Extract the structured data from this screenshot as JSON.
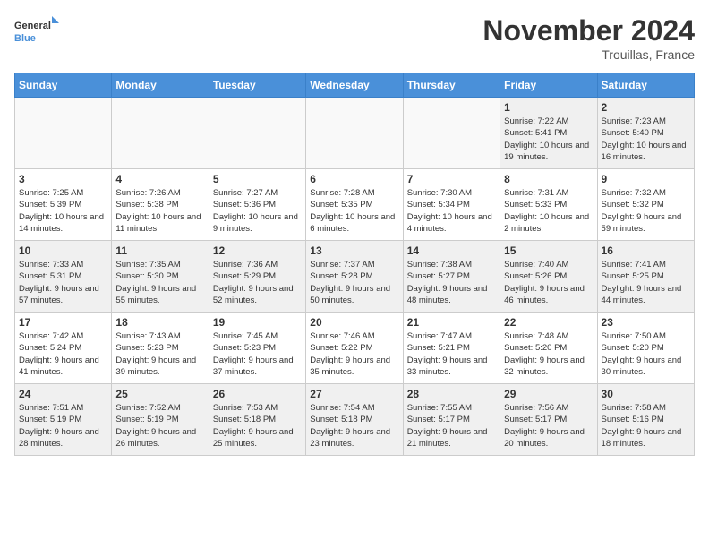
{
  "logo": {
    "line1": "General",
    "line2": "Blue"
  },
  "title": "November 2024",
  "location": "Trouillas, France",
  "days_of_week": [
    "Sunday",
    "Monday",
    "Tuesday",
    "Wednesday",
    "Thursday",
    "Friday",
    "Saturday"
  ],
  "weeks": [
    [
      {
        "day": "",
        "info": ""
      },
      {
        "day": "",
        "info": ""
      },
      {
        "day": "",
        "info": ""
      },
      {
        "day": "",
        "info": ""
      },
      {
        "day": "",
        "info": ""
      },
      {
        "day": "1",
        "info": "Sunrise: 7:22 AM\nSunset: 5:41 PM\nDaylight: 10 hours and 19 minutes."
      },
      {
        "day": "2",
        "info": "Sunrise: 7:23 AM\nSunset: 5:40 PM\nDaylight: 10 hours and 16 minutes."
      }
    ],
    [
      {
        "day": "3",
        "info": "Sunrise: 7:25 AM\nSunset: 5:39 PM\nDaylight: 10 hours and 14 minutes."
      },
      {
        "day": "4",
        "info": "Sunrise: 7:26 AM\nSunset: 5:38 PM\nDaylight: 10 hours and 11 minutes."
      },
      {
        "day": "5",
        "info": "Sunrise: 7:27 AM\nSunset: 5:36 PM\nDaylight: 10 hours and 9 minutes."
      },
      {
        "day": "6",
        "info": "Sunrise: 7:28 AM\nSunset: 5:35 PM\nDaylight: 10 hours and 6 minutes."
      },
      {
        "day": "7",
        "info": "Sunrise: 7:30 AM\nSunset: 5:34 PM\nDaylight: 10 hours and 4 minutes."
      },
      {
        "day": "8",
        "info": "Sunrise: 7:31 AM\nSunset: 5:33 PM\nDaylight: 10 hours and 2 minutes."
      },
      {
        "day": "9",
        "info": "Sunrise: 7:32 AM\nSunset: 5:32 PM\nDaylight: 9 hours and 59 minutes."
      }
    ],
    [
      {
        "day": "10",
        "info": "Sunrise: 7:33 AM\nSunset: 5:31 PM\nDaylight: 9 hours and 57 minutes."
      },
      {
        "day": "11",
        "info": "Sunrise: 7:35 AM\nSunset: 5:30 PM\nDaylight: 9 hours and 55 minutes."
      },
      {
        "day": "12",
        "info": "Sunrise: 7:36 AM\nSunset: 5:29 PM\nDaylight: 9 hours and 52 minutes."
      },
      {
        "day": "13",
        "info": "Sunrise: 7:37 AM\nSunset: 5:28 PM\nDaylight: 9 hours and 50 minutes."
      },
      {
        "day": "14",
        "info": "Sunrise: 7:38 AM\nSunset: 5:27 PM\nDaylight: 9 hours and 48 minutes."
      },
      {
        "day": "15",
        "info": "Sunrise: 7:40 AM\nSunset: 5:26 PM\nDaylight: 9 hours and 46 minutes."
      },
      {
        "day": "16",
        "info": "Sunrise: 7:41 AM\nSunset: 5:25 PM\nDaylight: 9 hours and 44 minutes."
      }
    ],
    [
      {
        "day": "17",
        "info": "Sunrise: 7:42 AM\nSunset: 5:24 PM\nDaylight: 9 hours and 41 minutes."
      },
      {
        "day": "18",
        "info": "Sunrise: 7:43 AM\nSunset: 5:23 PM\nDaylight: 9 hours and 39 minutes."
      },
      {
        "day": "19",
        "info": "Sunrise: 7:45 AM\nSunset: 5:23 PM\nDaylight: 9 hours and 37 minutes."
      },
      {
        "day": "20",
        "info": "Sunrise: 7:46 AM\nSunset: 5:22 PM\nDaylight: 9 hours and 35 minutes."
      },
      {
        "day": "21",
        "info": "Sunrise: 7:47 AM\nSunset: 5:21 PM\nDaylight: 9 hours and 33 minutes."
      },
      {
        "day": "22",
        "info": "Sunrise: 7:48 AM\nSunset: 5:20 PM\nDaylight: 9 hours and 32 minutes."
      },
      {
        "day": "23",
        "info": "Sunrise: 7:50 AM\nSunset: 5:20 PM\nDaylight: 9 hours and 30 minutes."
      }
    ],
    [
      {
        "day": "24",
        "info": "Sunrise: 7:51 AM\nSunset: 5:19 PM\nDaylight: 9 hours and 28 minutes."
      },
      {
        "day": "25",
        "info": "Sunrise: 7:52 AM\nSunset: 5:19 PM\nDaylight: 9 hours and 26 minutes."
      },
      {
        "day": "26",
        "info": "Sunrise: 7:53 AM\nSunset: 5:18 PM\nDaylight: 9 hours and 25 minutes."
      },
      {
        "day": "27",
        "info": "Sunrise: 7:54 AM\nSunset: 5:18 PM\nDaylight: 9 hours and 23 minutes."
      },
      {
        "day": "28",
        "info": "Sunrise: 7:55 AM\nSunset: 5:17 PM\nDaylight: 9 hours and 21 minutes."
      },
      {
        "day": "29",
        "info": "Sunrise: 7:56 AM\nSunset: 5:17 PM\nDaylight: 9 hours and 20 minutes."
      },
      {
        "day": "30",
        "info": "Sunrise: 7:58 AM\nSunset: 5:16 PM\nDaylight: 9 hours and 18 minutes."
      }
    ]
  ]
}
